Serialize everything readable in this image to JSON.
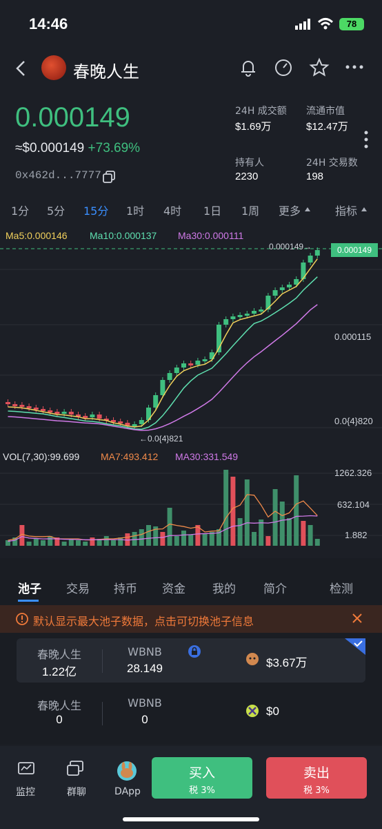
{
  "status": {
    "time": "14:46",
    "battery": "78"
  },
  "header": {
    "title": "春晚人生"
  },
  "price": {
    "main": "0.000149",
    "usd": "≈$0.000149",
    "change": "+73.69%",
    "address": "0x462d...7777"
  },
  "stats": [
    {
      "label": "24H 成交额",
      "value": "$1.69万"
    },
    {
      "label": "流通市值",
      "value": "$12.47万"
    },
    {
      "label": "持有人",
      "value": "2230"
    },
    {
      "label": "24H 交易数",
      "value": "198"
    }
  ],
  "timeframes": [
    "1分",
    "5分",
    "15分",
    "1时",
    "4时",
    "1日",
    "1周",
    "更多",
    "指标"
  ],
  "active_timeframe": "15分",
  "ma": {
    "ma5": "Ma5:0.000146",
    "ma10": "Ma10:0.000137",
    "ma30": "Ma30:0.000111"
  },
  "price_axis": {
    "top_marker": "0.000149→",
    "tag": "0.000149",
    "mid": "0.000115",
    "low": "0.0{4}820",
    "min_marker": "←0.0{4}821"
  },
  "vol": {
    "label": "VOL(7,30):99.699",
    "ma7": "MA7:493.412",
    "ma30": "MA30:331.549",
    "axis": [
      "1262.326",
      "632.104",
      "1.882"
    ]
  },
  "pool_tabs": [
    "池子",
    "交易",
    "持币",
    "资金",
    "我的",
    "简介",
    "检测"
  ],
  "notice": "默认显示最大池子数据，点击可切换池子信息",
  "pools": [
    {
      "name": "春晚人生",
      "amount": "1.22亿",
      "pair": "WBNB",
      "pair_amount": "28.149",
      "liquidity": "$3.67万"
    },
    {
      "name": "春晚人生",
      "amount": "0",
      "pair": "WBNB",
      "pair_amount": "0",
      "liquidity": "$0"
    }
  ],
  "bottom_nav": [
    {
      "label": "监控",
      "icon": "monitor-icon"
    },
    {
      "label": "群聊",
      "icon": "chat-icon"
    },
    {
      "label": "DApp",
      "icon": "dapp-icon"
    }
  ],
  "buy": {
    "label": "买入",
    "tax": "税 3%"
  },
  "sell": {
    "label": "卖出",
    "tax": "税 3%"
  },
  "colors": {
    "up": "#3fbf7f",
    "down": "#e0505a",
    "accent": "#3a8fff",
    "warning": "#f07a3a"
  }
}
